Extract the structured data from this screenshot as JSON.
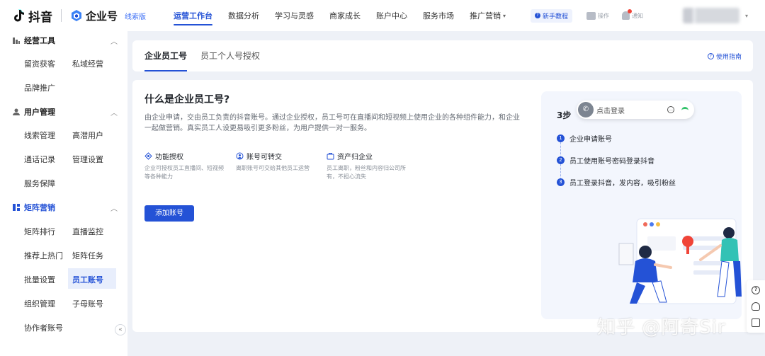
{
  "header": {
    "brand_douyin": "抖音",
    "brand_enterprise": "企业号",
    "edition": "线索版",
    "nav": [
      {
        "label": "运营工作台",
        "active": true
      },
      {
        "label": "数据分析"
      },
      {
        "label": "学习与灵感"
      },
      {
        "label": "商家成长"
      },
      {
        "label": "账户中心"
      },
      {
        "label": "服务市场"
      },
      {
        "label": "推广营销",
        "dropdown": true
      }
    ],
    "tutorial": "新手教程",
    "tutorial_icon": "help-dot-icon",
    "message_label": "操作",
    "notify_label": "通知",
    "account_caret": "▾"
  },
  "sidebar": {
    "groups": [
      {
        "label": "经营工具",
        "icon": "bar-chart-icon",
        "items": [
          "留资获客",
          "私域经营",
          "品牌推广"
        ]
      },
      {
        "label": "用户管理",
        "icon": "user-icon",
        "items": [
          "线索管理",
          "高潜用户",
          "通话记录",
          "管理设置",
          "服务保障"
        ]
      },
      {
        "label": "矩阵营销",
        "icon": "grid-icon",
        "items": [
          "矩阵排行",
          "直播监控",
          "推荐上热门",
          "矩阵任务",
          "批量设置",
          "员工账号",
          "组织管理",
          "子母账号",
          "协作者账号"
        ]
      }
    ],
    "active_item": "员工账号",
    "collapse": "«"
  },
  "tabs": {
    "items": [
      "企业员工号",
      "员工个人号授权"
    ],
    "active": "企业员工号",
    "guide": "使用指南"
  },
  "intro": {
    "title": "什么是企业员工号?",
    "description": "由企业申请，交由员工负责的抖音账号。通过企业授权，员工号可在直播间和短视频上使用企业的各种组件能力，和企业一起做营销。真实员工人设更易吸引更多粉丝，为用户提供一对一服务。",
    "features": [
      {
        "title": "功能授权",
        "desc": "企业可授权员工直播间、短视频等各种能力",
        "icon": "authorize-icon"
      },
      {
        "title": "账号可转交",
        "desc": "离职账号可交给其他员工运营",
        "icon": "transfer-icon"
      },
      {
        "title": "资产归企业",
        "desc": "员工离职，粉丝和内容归公司所有，不担心流失",
        "icon": "asset-icon"
      }
    ],
    "add_button": "添加账号"
  },
  "steps_panel": {
    "title": "3步",
    "login_text": "点击登录",
    "steps": [
      "企业申请账号",
      "员工使用账号密码登录抖音",
      "员工登录抖音，发内容，吸引粉丝"
    ]
  },
  "watermark": "知乎 @阿奇Sir",
  "colors": {
    "accent": "#2452d6",
    "background": "#eef1f7",
    "panel": "#f3f6fd",
    "wifi": "#33c26a"
  }
}
